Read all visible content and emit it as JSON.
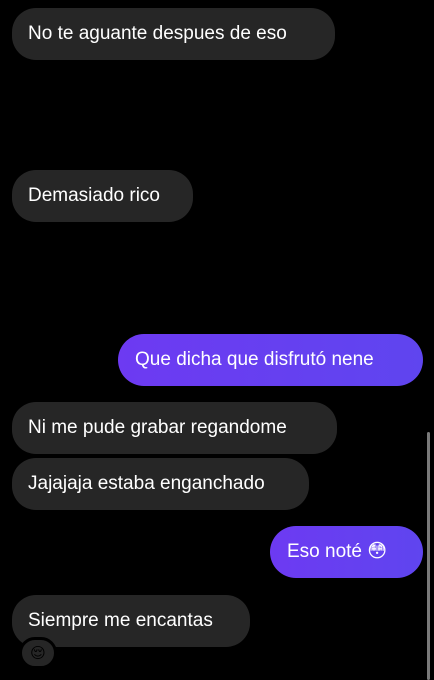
{
  "messages": {
    "m1": "No te aguante despues de eso",
    "m2_emoji": "🙀",
    "m3": "Demasiado rico",
    "m4_emoji": "😏",
    "m5": "Que dicha que disfrutó nene",
    "m6": "Ni me pude grabar regandome",
    "m7": "Jajajaja estaba enganchado",
    "m8": "Eso noté 😳",
    "m9": "Siempre me encantas",
    "m9_reaction": "😌"
  },
  "colors": {
    "background": "#000000",
    "incoming_bubble": "#262626",
    "outgoing_bubble": "#6a3cf1"
  }
}
